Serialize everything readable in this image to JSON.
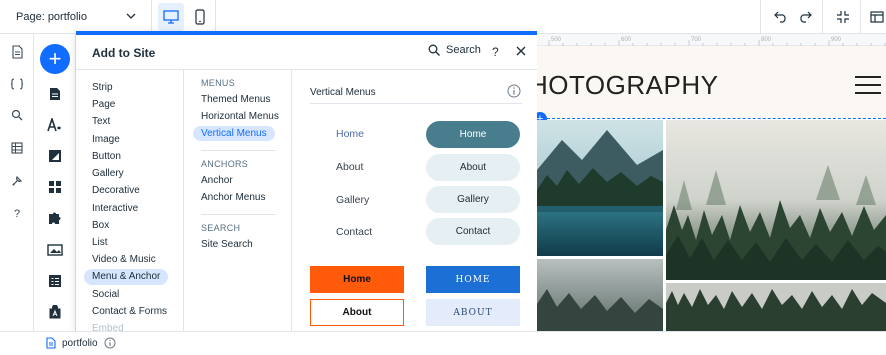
{
  "topbar": {
    "page_prefix": "Page:",
    "page_name": "portfolio",
    "device_desktop": "desktop-icon",
    "device_mobile": "mobile-icon",
    "undo": "undo-icon",
    "redo": "redo-icon",
    "zoom": "zoom-icon",
    "layout": "panel-icon"
  },
  "leftbar": {
    "items": [
      "pages-icon",
      "code-icon",
      "search-icon",
      "table-icon",
      "tools-icon",
      "help-icon"
    ]
  },
  "addbar": {
    "add_label": "+",
    "items": [
      "page-icon",
      "text-style-icon",
      "background-icon",
      "apps-icon",
      "puzzle-icon",
      "media-icon",
      "list-icon",
      "store-icon"
    ]
  },
  "panel": {
    "title": "Add to Site",
    "search_label": "Search",
    "help_label": "?",
    "categories": [
      "Strip",
      "Page",
      "Text",
      "Image",
      "Button",
      "Gallery",
      "Decorative",
      "Interactive",
      "Box",
      "List",
      "Video & Music",
      "Menu & Anchor",
      "Social",
      "Contact & Forms",
      "Embed"
    ],
    "active_category": "Menu & Anchor",
    "sections": {
      "menus_header": "MENUS",
      "menus": [
        "Themed Menus",
        "Horizontal Menus",
        "Vertical Menus"
      ],
      "anchors_header": "ANCHORS",
      "anchors": [
        "Anchor",
        "Anchor Menus"
      ],
      "search_header": "SEARCH",
      "search": [
        "Site Search"
      ]
    },
    "active_sub": "Vertical Menus",
    "preview": {
      "title": "Vertical Menus",
      "left_menu": [
        "Home",
        "About",
        "Gallery",
        "Contact"
      ],
      "pill_menu": [
        "Home",
        "About",
        "Gallery",
        "Contact"
      ],
      "orange_menu": [
        "Home",
        "About"
      ],
      "blue_menu": [
        "HOME",
        "ABOUT"
      ]
    }
  },
  "canvas": {
    "ruler_ticks": [
      "500",
      "600",
      "700",
      "800",
      "900"
    ],
    "site_title": "HOTOGRAPHY",
    "add_marker": "+"
  },
  "bottombar": {
    "page_name": "portfolio"
  },
  "colors": {
    "accent": "#116dff",
    "active_bg": "#d7e6ff",
    "pill_dark": "#477d8d",
    "pill_light": "#e6eff3",
    "orange": "#ff5b0a",
    "blue": "#1c6fd4"
  }
}
